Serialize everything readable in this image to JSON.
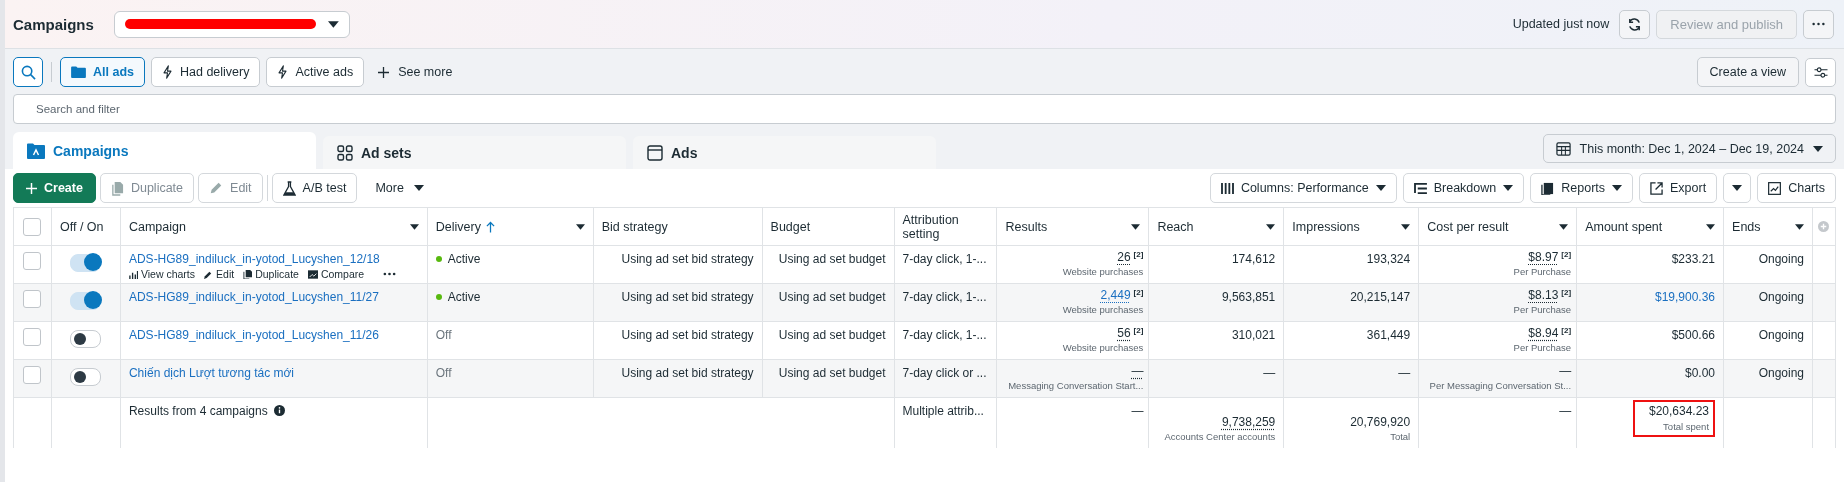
{
  "header": {
    "title": "Campaigns",
    "updated": "Updated just now",
    "publish_button": {
      "label": "Review and publish",
      "disabled": true
    }
  },
  "filters": {
    "chips": [
      {
        "label": "All ads",
        "selected": true
      },
      {
        "label": "Had delivery",
        "selected": false
      },
      {
        "label": "Active ads",
        "selected": false
      }
    ],
    "see_more": "See more",
    "create_view": "Create a view",
    "search": {
      "placeholder": "Search and filter"
    }
  },
  "tabs": [
    {
      "label": "Campaigns",
      "selected": true
    },
    {
      "label": "Ad sets",
      "selected": false
    },
    {
      "label": "Ads",
      "selected": false
    }
  ],
  "date_range": "This month: Dec 1, 2024 – Dec 19, 2024",
  "toolbar": {
    "left": [
      {
        "label": "Create",
        "kind": "primary",
        "disabled": false
      },
      {
        "label": "Duplicate",
        "kind": "plain",
        "disabled": true
      },
      {
        "label": "Edit",
        "kind": "plain",
        "disabled": true
      },
      {
        "label": "A/B test",
        "kind": "plain",
        "disabled": false
      },
      {
        "label": "More",
        "kind": "menu",
        "disabled": false
      }
    ],
    "right": [
      {
        "label": "Columns: Performance",
        "caret": true
      },
      {
        "label": "Breakdown",
        "caret": true
      },
      {
        "label": "Reports",
        "caret": true
      },
      {
        "label": "Export",
        "caret": false
      },
      {
        "label": "Charts",
        "caret": false
      }
    ]
  },
  "table": {
    "select_all": {
      "checked": false
    },
    "columns": [
      {
        "label": "Off / On",
        "menu": false,
        "sorted": false
      },
      {
        "label": "Campaign",
        "menu": true,
        "sorted": false
      },
      {
        "label": "Delivery",
        "menu": true,
        "sorted": true
      },
      {
        "label": "Bid strategy",
        "menu": false,
        "sorted": false
      },
      {
        "label": "Budget",
        "menu": false,
        "sorted": false
      },
      {
        "label": "Attribution setting",
        "menu": false,
        "sorted": false
      },
      {
        "label": "Results",
        "menu": true,
        "sorted": false
      },
      {
        "label": "Reach",
        "menu": true,
        "sorted": false
      },
      {
        "label": "Impressions",
        "menu": true,
        "sorted": false
      },
      {
        "label": "Cost per result",
        "menu": true,
        "sorted": false
      },
      {
        "label": "Amount spent",
        "menu": true,
        "sorted": false
      },
      {
        "label": "Ends",
        "menu": true,
        "sorted": false
      }
    ],
    "row_actions": [
      "View charts",
      "Edit",
      "Duplicate",
      "Compare"
    ],
    "rows": [
      {
        "checked": false,
        "on": true,
        "campaign": "ADS-HG89_indiluck_in-yotod_Lucyshen_12/18",
        "hovered": true,
        "delivery": "Active",
        "active": true,
        "bid_strategy": "Using ad set bid strategy",
        "budget": "Using ad set budget",
        "attribution": "7-day click, 1-...",
        "results": {
          "value": "26",
          "link": false,
          "note": "[2]",
          "sub": "Website purchases"
        },
        "reach": "174,612",
        "impressions": "193,324",
        "cost": {
          "value": "$8.97",
          "note": "[2]",
          "sub": "Per Purchase"
        },
        "amount": {
          "value": "$233.21",
          "link": false
        },
        "ends": "Ongoing"
      },
      {
        "checked": false,
        "on": true,
        "campaign": "ADS-HG89_indiluck_in-yotod_Lucyshen_11/27",
        "hovered": false,
        "delivery": "Active",
        "active": true,
        "bid_strategy": "Using ad set bid strategy",
        "budget": "Using ad set budget",
        "attribution": "7-day click, 1-...",
        "results": {
          "value": "2,449",
          "link": true,
          "note": "[2]",
          "sub": "Website purchases"
        },
        "reach": "9,563,851",
        "impressions": "20,215,147",
        "cost": {
          "value": "$8.13",
          "note": "[2]",
          "sub": "Per Purchase"
        },
        "amount": {
          "value": "$19,900.36",
          "link": true
        },
        "ends": "Ongoing"
      },
      {
        "checked": false,
        "on": false,
        "campaign": "ADS-HG89_indiluck_in-yotod_Lucyshen_11/26",
        "hovered": false,
        "delivery": "Off",
        "active": false,
        "bid_strategy": "Using ad set bid strategy",
        "budget": "Using ad set budget",
        "attribution": "7-day click, 1-...",
        "results": {
          "value": "56",
          "link": false,
          "note": "[2]",
          "sub": "Website purchases"
        },
        "reach": "310,021",
        "impressions": "361,449",
        "cost": {
          "value": "$8.94",
          "note": "[2]",
          "sub": "Per Purchase"
        },
        "amount": {
          "value": "$500.66",
          "link": false
        },
        "ends": "Ongoing"
      },
      {
        "checked": false,
        "on": false,
        "campaign": "Chiến dịch Lượt tương tác mới",
        "hovered": false,
        "delivery": "Off",
        "active": false,
        "bid_strategy": "Using ad set bid strategy",
        "budget": "Using ad set budget",
        "attribution": "7-day click or ...",
        "results": {
          "value": "—",
          "link": false,
          "sub": "Messaging Conversation Start..."
        },
        "reach": "—",
        "impressions": "—",
        "cost": {
          "value": "—",
          "sub": "Per Messaging Conversation St..."
        },
        "amount": {
          "value": "$0.00",
          "link": false
        },
        "ends": "Ongoing"
      }
    ],
    "footer": {
      "label": "Results from 4 campaigns",
      "attribution": "Multiple attrib...",
      "results": "—",
      "reach": "9,738,259",
      "reach_sub": "Accounts Center accounts",
      "impressions": "20,769,920",
      "impressions_sub": "Total",
      "cost": "—",
      "amount": "$20,634.23",
      "amount_sub": "Total spent",
      "amount_highlighted": true
    }
  }
}
